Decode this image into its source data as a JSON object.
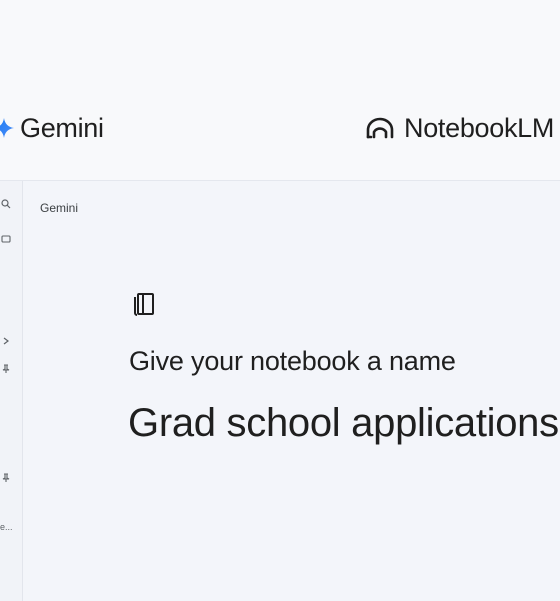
{
  "brands": {
    "gemini": {
      "name": "Gemini",
      "icon": "gemini-star-icon",
      "accent": "#4285f4"
    },
    "notebooklm": {
      "name": "NotebookLM",
      "icon": "notebooklm-logo-icon"
    }
  },
  "app": {
    "breadcrumb": "Gemini",
    "notebook_icon": "notebook-icon",
    "prompt": "Give your notebook a name",
    "notebook_title": "Grad school applications",
    "rail": {
      "icons": [
        "search-icon",
        "window-icon",
        "chevron-right-icon",
        "pin-icon",
        "pin-icon"
      ],
      "label": "e..."
    }
  }
}
